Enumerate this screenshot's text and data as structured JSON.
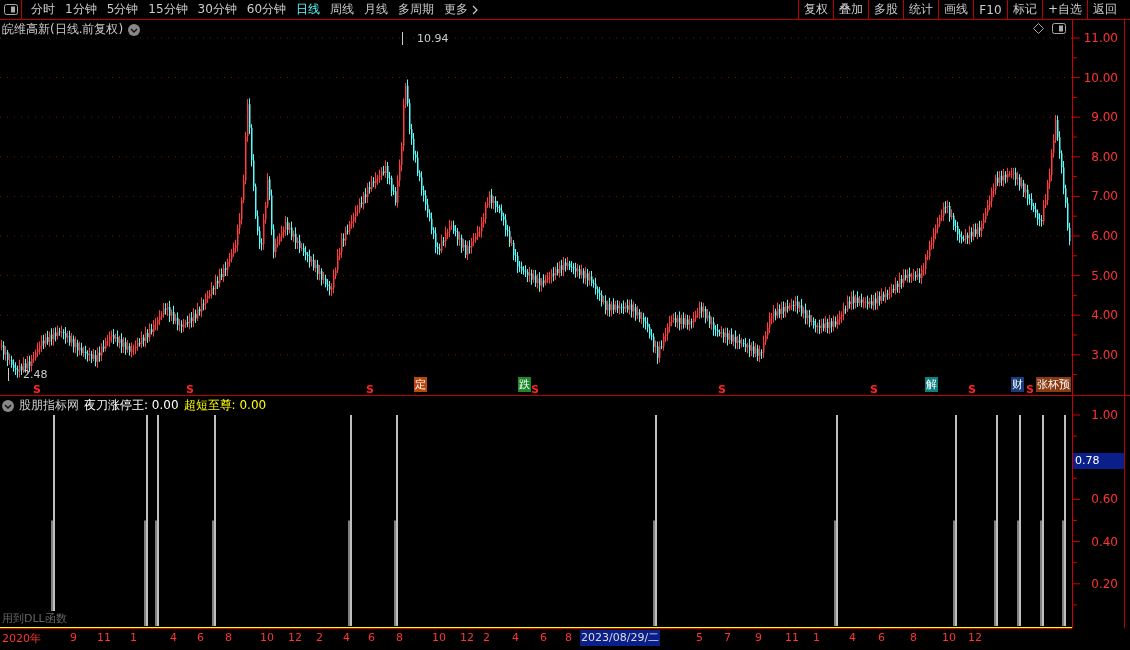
{
  "toolbar": {
    "periods": [
      {
        "label": "分时",
        "selected": false
      },
      {
        "label": "1分钟",
        "selected": false
      },
      {
        "label": "5分钟",
        "selected": false
      },
      {
        "label": "15分钟",
        "selected": false
      },
      {
        "label": "30分钟",
        "selected": false
      },
      {
        "label": "60分钟",
        "selected": false
      },
      {
        "label": "日线",
        "selected": true
      },
      {
        "label": "周线",
        "selected": false
      },
      {
        "label": "月线",
        "selected": false
      },
      {
        "label": "多周期",
        "selected": false
      }
    ],
    "more": "更多",
    "actions": [
      "复权",
      "叠加",
      "多股",
      "统计",
      "画线",
      "F10",
      "标记",
      "+自选",
      "返回"
    ]
  },
  "chart": {
    "title": "皖维高新(日线.前复权)",
    "high_label": "10.94",
    "low_label": "2.48",
    "price_axis": [
      "11.00",
      "10.00",
      "9.00",
      "8.00",
      "7.00",
      "6.00",
      "5.00",
      "4.00",
      "3.00"
    ],
    "markers": [
      {
        "kind": "s",
        "text": "S"
      },
      {
        "kind": "s",
        "text": "S"
      },
      {
        "kind": "s",
        "text": "S"
      },
      {
        "kind": "badge",
        "text": "定",
        "color": "#b84a10"
      },
      {
        "kind": "badge",
        "text": "跌",
        "color": "#1d8a2a"
      },
      {
        "kind": "s",
        "text": "S"
      },
      {
        "kind": "s",
        "text": "S"
      },
      {
        "kind": "s",
        "text": "S"
      },
      {
        "kind": "badge",
        "text": "解",
        "color": "#0f8080"
      },
      {
        "kind": "s",
        "text": "S"
      },
      {
        "kind": "badge",
        "text": "财",
        "color": "#1a3c7a"
      },
      {
        "kind": "s",
        "text": "S"
      },
      {
        "kind": "badge",
        "text": "张杯预",
        "color": "#8a3a10"
      }
    ]
  },
  "indicator": {
    "name": "股朋指标网",
    "series": [
      {
        "label": "夜刀涨停王: 0.00",
        "color": "#ffffff"
      },
      {
        "label": "超短至尊: 0.00",
        "color": "#ffff00"
      }
    ],
    "axis": [
      "1.00",
      "0.60",
      "0.40",
      "0.20"
    ],
    "cursor_value": "0.78",
    "note": "用到DLL函数"
  },
  "date_axis": {
    "labels": [
      "2020年",
      "9",
      "11",
      "1",
      "4",
      "6",
      "8",
      "10",
      "12",
      "2",
      "4",
      "6",
      "8",
      "10",
      "12",
      "2",
      "4",
      "6",
      "8",
      "5",
      "7",
      "9",
      "11",
      "1",
      "4",
      "6",
      "8",
      "10",
      "12"
    ],
    "cursor_date": "2023/08/29/二"
  }
}
